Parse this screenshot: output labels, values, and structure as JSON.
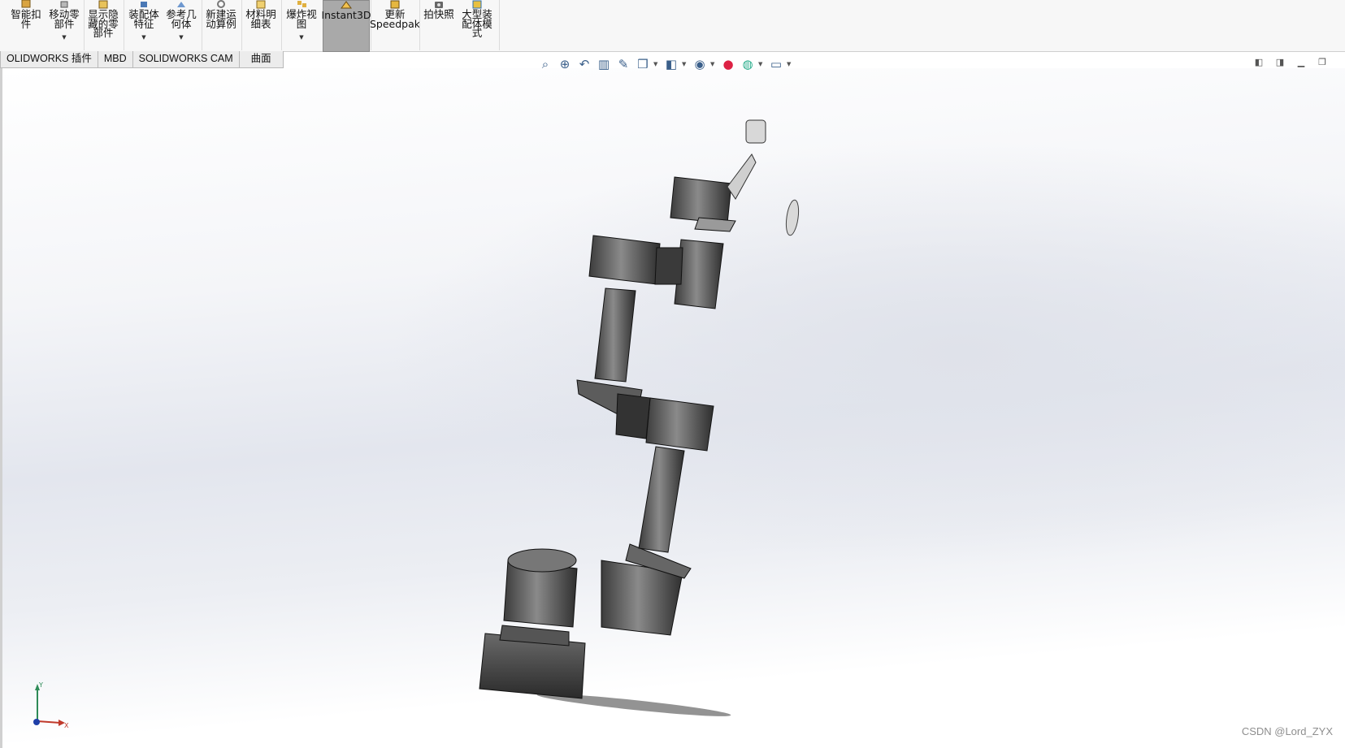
{
  "ribbon": {
    "buttons": [
      {
        "label": "智能扣\n件",
        "icon": "smart-fastener-icon",
        "dropdown": false
      },
      {
        "label": "移动零\n部件",
        "icon": "move-component-icon",
        "dropdown": true
      },
      {
        "label": "显示隐\n藏的零\n部件",
        "icon": "show-hidden-icon",
        "dropdown": false
      },
      {
        "label": "装配体\n特征",
        "icon": "assembly-feature-icon",
        "dropdown": true
      },
      {
        "label": "参考几\n何体",
        "icon": "reference-geometry-icon",
        "dropdown": true
      },
      {
        "label": "新建运\n动算例",
        "icon": "motion-study-icon",
        "dropdown": false
      },
      {
        "label": "材料明\n细表",
        "icon": "bill-of-materials-icon",
        "dropdown": false
      },
      {
        "label": "爆炸视\n图",
        "icon": "exploded-view-icon",
        "dropdown": true
      },
      {
        "label": "Instant3D",
        "icon": "instant3d-icon",
        "dropdown": false,
        "active": true
      },
      {
        "label": "更新\nSpeedpak",
        "icon": "speedpak-icon",
        "dropdown": false
      },
      {
        "label": "拍快照",
        "icon": "snapshot-icon",
        "dropdown": false
      },
      {
        "label": "大型装\n配体模\n式",
        "icon": "large-assembly-icon",
        "dropdown": false
      }
    ]
  },
  "tabs": [
    "OLIDWORKS 插件",
    "MBD",
    "SOLIDWORKS CAM",
    "曲面"
  ],
  "hud_icons": [
    "zoom-to-fit-icon",
    "zoom-to-area-icon",
    "previous-view-icon",
    "section-view-icon",
    "dynamic-annotation-icon",
    "view-orientation-icon",
    "display-style-icon",
    "hide-show-items-icon",
    "edit-appearance-icon",
    "apply-scene-icon",
    "view-settings-icon"
  ],
  "window_controls": [
    "tile-left-icon",
    "tile-right-icon",
    "minimize-icon",
    "restore-icon"
  ],
  "triad": {
    "x": "X",
    "y": "Y"
  },
  "watermark": "CSDN @Lord_ZYX",
  "colors": {
    "active_button": "#a9a9a9",
    "axis_x": "#c0392b",
    "axis_y": "#2e8b57",
    "axis_z": "#1f3fa8"
  }
}
